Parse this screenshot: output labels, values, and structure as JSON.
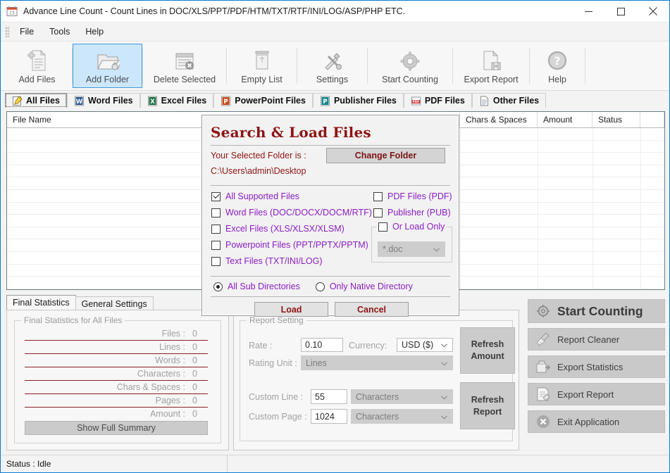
{
  "window": {
    "title": "Advance Line Count - Count Lines in DOC/XLS/PPT/PDF/HTM/TXT/RTF/INI/LOG/ASP/PHP ETC.",
    "icon": "calendar-icon",
    "minimize": "minimize-button",
    "maximize": "maximize-button",
    "close": "close-button"
  },
  "menu": {
    "items": [
      "File",
      "Tools",
      "Help"
    ]
  },
  "toolbar": {
    "buttons": [
      {
        "label": "Add Files",
        "icon": "add-file-icon",
        "selected": false
      },
      {
        "label": "Add Folder",
        "icon": "add-folder-icon",
        "selected": true
      },
      {
        "label": "Delete Selected",
        "icon": "delete-icon",
        "selected": false
      },
      {
        "label": "Empty List",
        "icon": "trash-icon",
        "selected": false
      },
      {
        "label": "Settings",
        "icon": "tools-icon",
        "selected": false
      },
      {
        "label": "Start Counting",
        "icon": "gear-icon",
        "selected": false
      },
      {
        "label": "Export Report",
        "icon": "export-icon",
        "selected": false
      },
      {
        "label": "Help",
        "icon": "help-icon",
        "selected": false
      }
    ]
  },
  "file_tabs": [
    {
      "label": "All Files",
      "icon": "all-files-icon",
      "active": true
    },
    {
      "label": "Word Files",
      "icon": "word-icon",
      "active": false
    },
    {
      "label": "Excel Files",
      "icon": "excel-icon",
      "active": false
    },
    {
      "label": "PowerPoint Files",
      "icon": "powerpoint-icon",
      "active": false
    },
    {
      "label": "Publisher Files",
      "icon": "publisher-icon",
      "active": false
    },
    {
      "label": "PDF Files",
      "icon": "pdf-icon",
      "active": false
    },
    {
      "label": "Other Files",
      "icon": "other-files-icon",
      "active": false
    }
  ],
  "file_list": {
    "columns": [
      "File Name",
      "Chars & Spaces",
      "Amount",
      "Status"
    ],
    "rows": []
  },
  "bottom_tabs": [
    {
      "label": "Final Statistics",
      "active": true
    },
    {
      "label": "General Settings",
      "active": false
    }
  ],
  "final_statistics": {
    "group_title": "Final Statistics for All Files",
    "rows": [
      {
        "label": "Files :",
        "value": "0"
      },
      {
        "label": "Lines :",
        "value": "0"
      },
      {
        "label": "Words :",
        "value": "0"
      },
      {
        "label": "Characters :",
        "value": "0"
      },
      {
        "label": "Chars & Spaces :",
        "value": "0"
      },
      {
        "label": "Pages :",
        "value": "0"
      },
      {
        "label": "Amount :",
        "value": "0"
      }
    ],
    "summary_button": "Show Full Summary"
  },
  "report_setting": {
    "group_title": "Report Setting",
    "rate_label": "Rate :",
    "rate_value": "0.10",
    "currency_label": "Currency:",
    "currency_value": "USD ($)",
    "rating_unit_label": "Rating Unit :",
    "rating_unit_value": "Lines",
    "custom_line_label": "Custom Line :",
    "custom_line_value": "55",
    "custom_line_unit": "Characters",
    "custom_page_label": "Custom Page :",
    "custom_page_value": "1024",
    "custom_page_unit": "Characters",
    "refresh_amount": "Refresh\nAmount",
    "refresh_amount_l1": "Refresh",
    "refresh_amount_l2": "Amount",
    "refresh_report_l1": "Refresh",
    "refresh_report_l2": "Report"
  },
  "actions": [
    {
      "label": "Start Counting",
      "icon": "gear-icon"
    },
    {
      "label": "Report Cleaner",
      "icon": "broom-icon"
    },
    {
      "label": "Export Statistics",
      "icon": "export-stats-icon"
    },
    {
      "label": "Export Report",
      "icon": "export-report-icon"
    },
    {
      "label": "Exit Application",
      "icon": "exit-icon"
    }
  ],
  "status_bar": {
    "text": "Status : Idle"
  },
  "dialog": {
    "title": "Search & Load Files",
    "folder_label": "Your Selected Folder is :",
    "change_folder_button": "Change Folder",
    "folder_path": "C:\\Users\\admin\\Desktop",
    "checkboxes_left": [
      {
        "label": "All Supported Files",
        "checked": true
      },
      {
        "label": "Word Files (DOC/DOCX/DOCM/RTF)",
        "checked": false
      },
      {
        "label": "Excel Files (XLS/XLSX/XLSM)",
        "checked": false
      },
      {
        "label": "Powerpoint Files (PPT/PPTX/PPTM)",
        "checked": false
      },
      {
        "label": "Text Files (TXT/INI/LOG)",
        "checked": false
      }
    ],
    "checkboxes_right": [
      {
        "label": "PDF Files (PDF)",
        "checked": false
      },
      {
        "label": "Publisher (PUB)",
        "checked": false
      }
    ],
    "or_load_only": {
      "label": "Or Load Only",
      "checked": false,
      "value": "*.doc"
    },
    "radios": [
      {
        "label": "All Sub Directories",
        "selected": true
      },
      {
        "label": "Only Native Directory",
        "selected": false
      }
    ],
    "load_button": "Load",
    "cancel_button": "Cancel"
  },
  "colors": {
    "accent_blue": "#0a7cd6",
    "selected_tool": "#cce7fb",
    "dialog_red": "#8e1414",
    "checkbox_purple": "#8c1cc4",
    "stat_rule": "#8b1f1f"
  }
}
